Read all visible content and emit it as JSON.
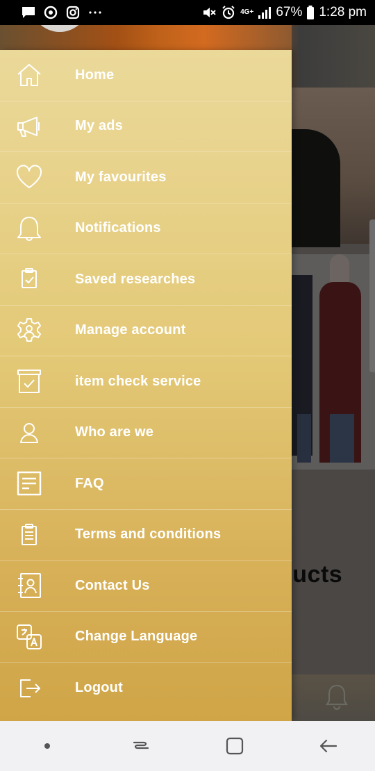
{
  "status_bar": {
    "battery": "67%",
    "time": "1:28 pm",
    "network": "4G+",
    "left_icons": [
      "message-icon",
      "sync-icon",
      "instagram-icon",
      "more-icon"
    ],
    "right_icons": [
      "mute-icon",
      "alarm-icon",
      "network-icon",
      "signal-icon",
      "battery-icon"
    ]
  },
  "background": {
    "heading_fragment": "ducts"
  },
  "drawer": {
    "items": [
      {
        "label": "Home",
        "icon": "home-icon"
      },
      {
        "label": "My ads",
        "icon": "megaphone-icon"
      },
      {
        "label": "My favourites",
        "icon": "heart-icon"
      },
      {
        "label": "Notifications",
        "icon": "bell-icon"
      },
      {
        "label": "Saved researches",
        "icon": "clipboard-check-icon"
      },
      {
        "label": "Manage account",
        "icon": "gear-user-icon"
      },
      {
        "label": "item check service",
        "icon": "box-check-icon"
      },
      {
        "label": "Who are we",
        "icon": "person-icon"
      },
      {
        "label": "FAQ",
        "icon": "document-lines-icon"
      },
      {
        "label": "Terms and conditions",
        "icon": "clipboard-list-icon"
      },
      {
        "label": "Contact Us",
        "icon": "contact-book-icon"
      },
      {
        "label": "Change Language",
        "icon": "translate-icon"
      },
      {
        "label": "Logout",
        "icon": "logout-icon"
      }
    ]
  },
  "colors": {
    "drawer_top": "#ebd99a",
    "drawer_bottom": "#cfa547",
    "text": "#ffffff",
    "nav_bar": "#f1f0f3"
  }
}
